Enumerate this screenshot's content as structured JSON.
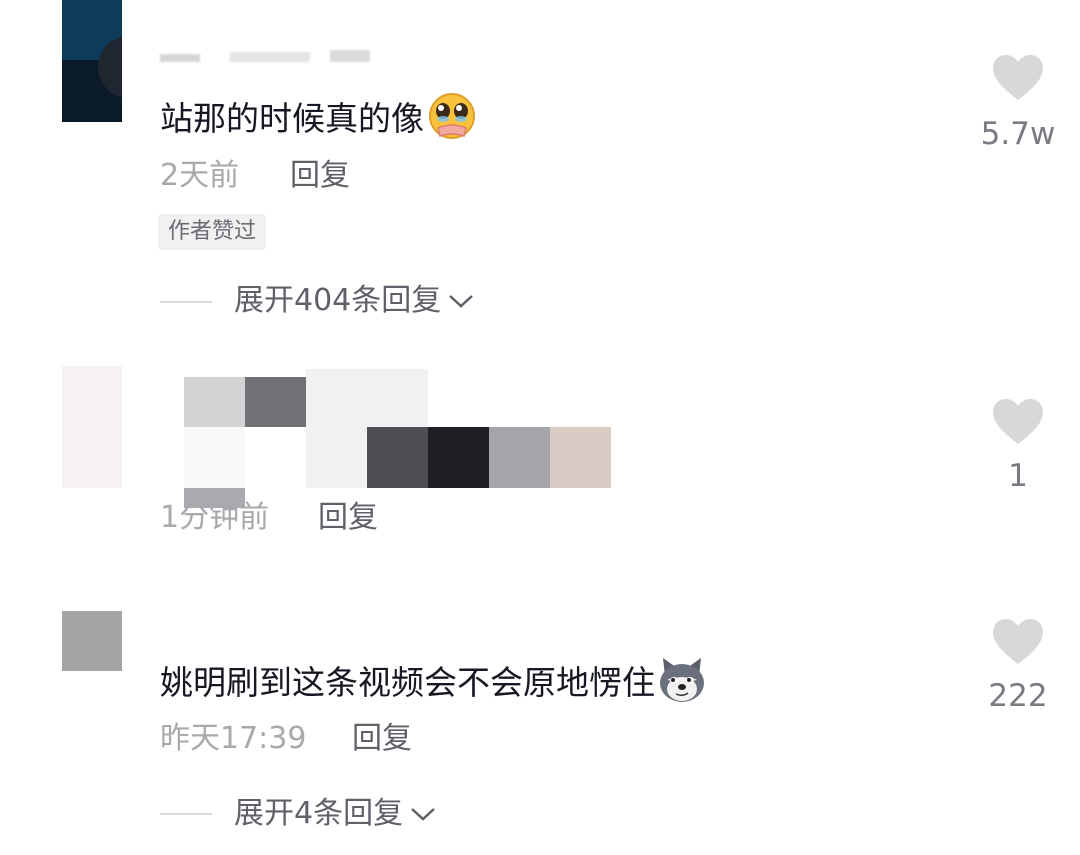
{
  "comments": [
    {
      "username": "",
      "text": "站那的时候真的像",
      "emoji": "pleading-face-emoji",
      "time": "2天前",
      "reply_label": "回复",
      "badge": "作者赞过",
      "expand_label": "展开404条回复",
      "like_count": "5.7w"
    },
    {
      "text": "",
      "time": "1分钟前",
      "reply_label": "回复",
      "like_count": "1"
    },
    {
      "text": "姚明刷到这条视频会不会原地愣住",
      "emoji": "husky-dog-emoji",
      "time": "昨天17:39",
      "reply_label": "回复",
      "expand_label": "展开4条回复",
      "like_count": "222"
    }
  ],
  "icons": {
    "like": "heart-icon",
    "expand": "chevron-down-icon"
  },
  "colors": {
    "heart": "#d8d8da",
    "text": "#161823",
    "meta": "#a8a8ad"
  }
}
